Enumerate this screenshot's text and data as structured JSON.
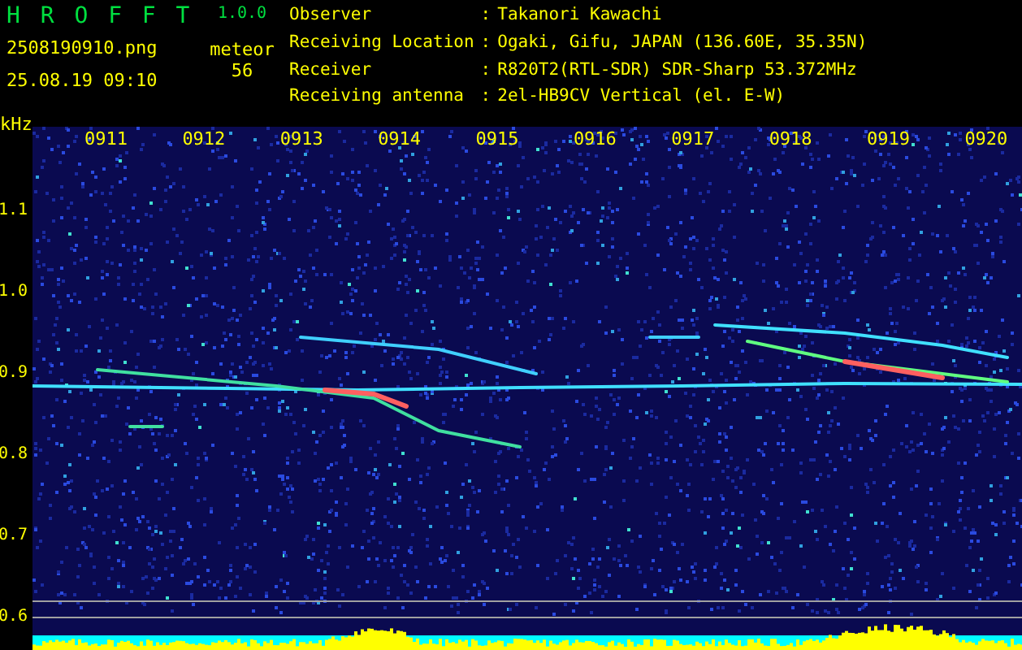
{
  "app": {
    "title": "H R O F F T",
    "version": "1.0.0"
  },
  "file": {
    "name": "2508190910.png",
    "datetime": "25.08.19 09:10"
  },
  "meteor": {
    "label": "meteor",
    "count": "56"
  },
  "info": [
    {
      "label": "Observer",
      "separator": ":",
      "value": "Takanori Kawachi"
    },
    {
      "label": "Receiving Location",
      "separator": ":",
      "value": "Ogaki, Gifu, JAPAN (136.60E, 35.35N)"
    },
    {
      "label": "Receiver",
      "separator": ":",
      "value": "R820T2(RTL-SDR) SDR-Sharp 53.372MHz"
    },
    {
      "label": "Receiving antenna",
      "separator": ":",
      "value": "2el-HB9CV Vertical (el. E-W)"
    }
  ],
  "spectrogram": {
    "unit": "kHz",
    "frequency_labels": [
      "1.1",
      "1.0",
      "0.9",
      "0.8",
      "0.7",
      "0.6"
    ],
    "time_labels": [
      "0911",
      "0912",
      "0913",
      "0914",
      "0915",
      "0916",
      "0917",
      "0918",
      "0919",
      "0920"
    ]
  }
}
